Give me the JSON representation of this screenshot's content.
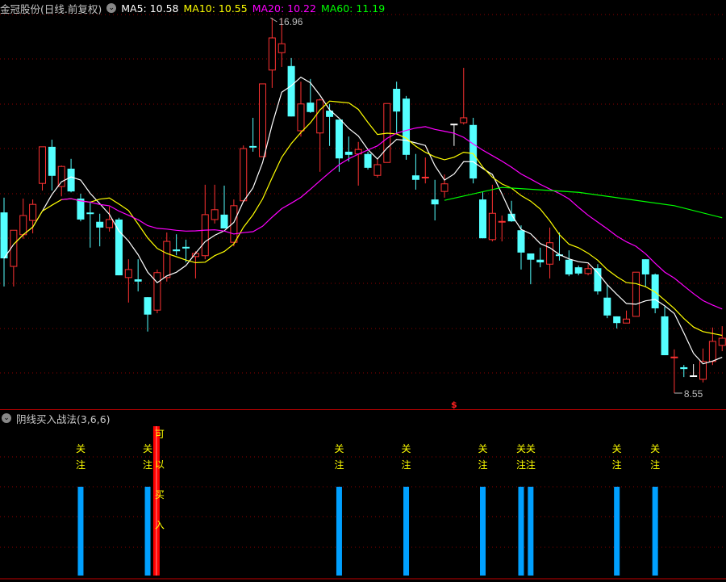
{
  "header": {
    "title": "金冠股份(日线.前复权)",
    "ma5": "MA5: 10.58",
    "ma10": "MA10: 10.55",
    "ma20": "MA20: 10.22",
    "ma60": "MA60: 11.19"
  },
  "indicator": {
    "title": "阴线买入战法(3,6,6)",
    "watch_char1": "关",
    "watch_char2": "注",
    "buy_label": [
      "可",
      "以",
      "买",
      "入"
    ],
    "watch_indices": [
      8,
      15,
      35,
      42,
      50,
      54,
      55,
      64,
      68
    ],
    "buy_index": 16
  },
  "colors": {
    "up": "#ff3232",
    "down": "#54ffff",
    "flat": "#ffffff",
    "ma5": "#ffffff",
    "ma10": "#ffff00",
    "ma20": "#ff00ff",
    "ma60": "#00ff00",
    "grid": "#8b0000",
    "signal": "#00a0ff",
    "buy": "#ff0000"
  },
  "chart_data": {
    "type": "candlestick",
    "price_high_label": "16.96",
    "price_low_label": "8.55",
    "high_index": 28,
    "low_index": 70,
    "marker": "$",
    "candles": [
      [
        12.6,
        12.93,
        10.94,
        11.57,
        "c"
      ],
      [
        11.39,
        12.2,
        10.94,
        12.2,
        "r"
      ],
      [
        12.1,
        12.91,
        12.01,
        12.53,
        "r"
      ],
      [
        12.42,
        12.89,
        12.13,
        12.78,
        "r"
      ],
      [
        13.25,
        14.07,
        13.09,
        14.07,
        "r"
      ],
      [
        14.07,
        14.23,
        13.09,
        13.42,
        "c"
      ],
      [
        13.18,
        13.65,
        12.96,
        13.63,
        "r"
      ],
      [
        13.58,
        13.8,
        13.05,
        13.07,
        "c"
      ],
      [
        12.91,
        13.02,
        12.4,
        12.44,
        "c"
      ],
      [
        12.58,
        12.84,
        11.81,
        12.58,
        "c"
      ],
      [
        12.39,
        12.57,
        11.84,
        12.26,
        "c"
      ],
      [
        12.26,
        12.73,
        12.17,
        12.44,
        "r"
      ],
      [
        12.44,
        12.48,
        11.19,
        11.19,
        "c"
      ],
      [
        11.14,
        11.55,
        10.58,
        11.32,
        "r"
      ],
      [
        11.1,
        11.55,
        10.83,
        11.05,
        "c"
      ],
      [
        10.7,
        10.7,
        9.93,
        10.31,
        "c"
      ],
      [
        10.41,
        11.32,
        10.34,
        11.25,
        "r"
      ],
      [
        11.14,
        12.15,
        11.05,
        11.95,
        "r"
      ],
      [
        11.77,
        12.11,
        11.64,
        11.73,
        "c"
      ],
      [
        11.81,
        11.99,
        11.48,
        11.81,
        "c"
      ],
      [
        11.61,
        11.73,
        11.12,
        11.68,
        "r"
      ],
      [
        11.63,
        13.22,
        11.55,
        12.55,
        "r"
      ],
      [
        12.44,
        13.22,
        12.35,
        12.66,
        "r"
      ],
      [
        12.55,
        13.2,
        12.24,
        12.24,
        "c"
      ],
      [
        11.93,
        12.89,
        11.84,
        12.75,
        "r"
      ],
      [
        12.86,
        14.1,
        12.84,
        14.03,
        "r"
      ],
      [
        14.07,
        14.72,
        13.96,
        14.07,
        "c"
      ],
      [
        13.85,
        15.48,
        13.85,
        15.48,
        "r"
      ],
      [
        15.79,
        16.96,
        15.39,
        16.51,
        "r"
      ],
      [
        16.18,
        16.96,
        15.86,
        16.38,
        "r"
      ],
      [
        15.88,
        16.06,
        14.75,
        14.75,
        "c"
      ],
      [
        14.43,
        15.53,
        14.3,
        15.03,
        "r"
      ],
      [
        15.06,
        15.59,
        14.83,
        14.85,
        "c"
      ],
      [
        14.38,
        15.15,
        13.51,
        15.12,
        "r"
      ],
      [
        14.88,
        15.03,
        14.09,
        14.74,
        "c"
      ],
      [
        14.68,
        14.68,
        13.51,
        13.81,
        "c"
      ],
      [
        13.96,
        14.3,
        13.74,
        13.89,
        "c"
      ],
      [
        13.91,
        14.18,
        13.2,
        14.01,
        "r"
      ],
      [
        13.91,
        13.96,
        13.56,
        13.6,
        "c"
      ],
      [
        13.43,
        13.81,
        13.38,
        13.67,
        "r"
      ],
      [
        13.72,
        15.04,
        13.72,
        15.04,
        "r"
      ],
      [
        15.37,
        15.53,
        14.38,
        14.86,
        "c"
      ],
      [
        15.15,
        15.21,
        13.78,
        13.89,
        "c"
      ],
      [
        13.43,
        13.91,
        13.11,
        13.33,
        "c"
      ],
      [
        13.38,
        13.83,
        13.25,
        13.38,
        "r"
      ],
      [
        12.89,
        13.33,
        12.42,
        12.78,
        "c"
      ],
      [
        13.07,
        13.45,
        12.93,
        13.24,
        "r"
      ],
      [
        14.57,
        14.57,
        14.09,
        14.57,
        "w"
      ],
      [
        14.61,
        15.84,
        14.57,
        14.72,
        "r"
      ],
      [
        14.56,
        14.72,
        13.25,
        13.36,
        "c"
      ],
      [
        12.89,
        13.05,
        12.02,
        12.02,
        "c"
      ],
      [
        11.99,
        13.22,
        11.95,
        12.58,
        "r"
      ],
      [
        12.39,
        12.53,
        11.95,
        12.39,
        "r"
      ],
      [
        12.57,
        12.86,
        12.39,
        12.4,
        "c"
      ],
      [
        12.2,
        12.31,
        11.32,
        11.7,
        "c"
      ],
      [
        11.68,
        11.68,
        10.99,
        11.54,
        "c"
      ],
      [
        11.54,
        11.81,
        11.37,
        11.48,
        "c"
      ],
      [
        11.44,
        12.26,
        11.12,
        11.92,
        "r"
      ],
      [
        11.64,
        12.15,
        11.52,
        11.64,
        "c"
      ],
      [
        11.54,
        11.75,
        11.17,
        11.21,
        "c"
      ],
      [
        11.37,
        11.41,
        11.19,
        11.23,
        "c"
      ],
      [
        11.23,
        11.44,
        11.19,
        11.34,
        "r"
      ],
      [
        11.35,
        11.44,
        10.76,
        10.83,
        "c"
      ],
      [
        10.69,
        10.97,
        10.23,
        10.29,
        "c"
      ],
      [
        10.27,
        10.27,
        10.0,
        10.12,
        "c"
      ],
      [
        10.12,
        10.4,
        10.12,
        10.21,
        "r"
      ],
      [
        10.27,
        11.26,
        10.27,
        11.26,
        "r"
      ],
      [
        11.55,
        11.55,
        10.94,
        11.21,
        "c"
      ],
      [
        11.21,
        11.23,
        10.34,
        10.45,
        "c"
      ],
      [
        10.27,
        10.49,
        9.4,
        9.4,
        "c"
      ],
      [
        9.35,
        9.53,
        8.55,
        9.35,
        "r"
      ],
      [
        9.13,
        9.18,
        8.91,
        9.09,
        "c"
      ],
      [
        8.93,
        9.2,
        8.93,
        8.93,
        "w"
      ],
      [
        8.86,
        9.55,
        8.79,
        9.26,
        "r"
      ],
      [
        9.26,
        10.02,
        9.18,
        9.71,
        "r"
      ],
      [
        9.62,
        10.05,
        9.49,
        9.78,
        "r"
      ]
    ],
    "ma60_points": [
      [
        46,
        12.87
      ],
      [
        52,
        13.16
      ],
      [
        60,
        13.05
      ],
      [
        70,
        12.75
      ],
      [
        75,
        12.48
      ]
    ],
    "ylim": [
      8.2,
      17.36
    ]
  }
}
